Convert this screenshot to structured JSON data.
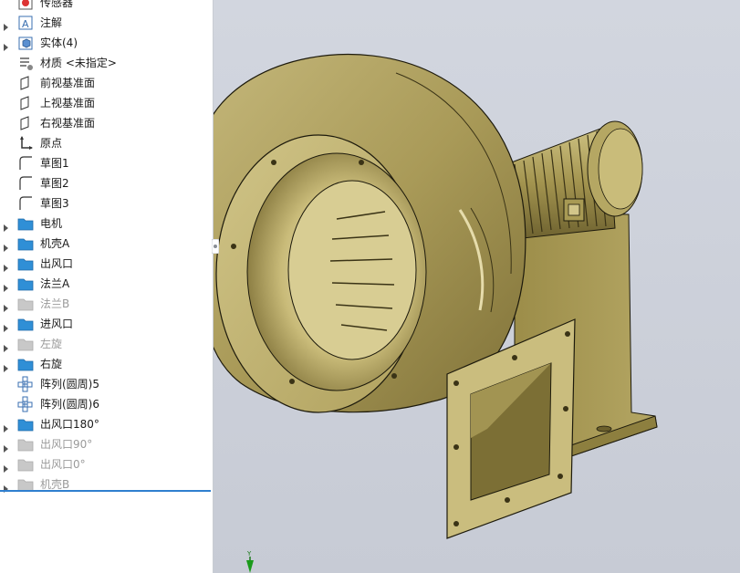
{
  "feature_tree": {
    "items": [
      {
        "label": "传感器",
        "icon": "sensor-icon",
        "expandable": false,
        "suppressed": false
      },
      {
        "label": "注解",
        "icon": "annotation-icon",
        "expandable": true,
        "suppressed": false
      },
      {
        "label": "实体(4)",
        "icon": "solid-bodies-icon",
        "expandable": true,
        "suppressed": false
      },
      {
        "label": "材质 <未指定>",
        "icon": "material-icon",
        "expandable": false,
        "suppressed": false
      },
      {
        "label": "前视基准面",
        "icon": "plane-icon",
        "expandable": false,
        "suppressed": false
      },
      {
        "label": "上视基准面",
        "icon": "plane-icon",
        "expandable": false,
        "suppressed": false
      },
      {
        "label": "右视基准面",
        "icon": "plane-icon",
        "expandable": false,
        "suppressed": false
      },
      {
        "label": "原点",
        "icon": "origin-icon",
        "expandable": false,
        "suppressed": false
      },
      {
        "label": "草图1",
        "icon": "sketch-icon",
        "expandable": false,
        "suppressed": false
      },
      {
        "label": "草图2",
        "icon": "sketch-icon",
        "expandable": false,
        "suppressed": false
      },
      {
        "label": "草图3",
        "icon": "sketch-icon",
        "expandable": false,
        "suppressed": false
      },
      {
        "label": "电机",
        "icon": "folder-icon",
        "expandable": true,
        "suppressed": false
      },
      {
        "label": "机壳A",
        "icon": "folder-icon",
        "expandable": true,
        "suppressed": false
      },
      {
        "label": "出风口",
        "icon": "folder-icon",
        "expandable": true,
        "suppressed": false
      },
      {
        "label": "法兰A",
        "icon": "folder-icon",
        "expandable": true,
        "suppressed": false
      },
      {
        "label": "法兰B",
        "icon": "folder-icon",
        "expandable": true,
        "suppressed": true
      },
      {
        "label": "进风口",
        "icon": "folder-icon",
        "expandable": true,
        "suppressed": false
      },
      {
        "label": "左旋",
        "icon": "folder-icon",
        "expandable": true,
        "suppressed": true
      },
      {
        "label": "右旋",
        "icon": "folder-icon",
        "expandable": true,
        "suppressed": false
      },
      {
        "label": "阵列(圆周)5",
        "icon": "circular-pattern-icon",
        "expandable": false,
        "suppressed": false
      },
      {
        "label": "阵列(圆周)6",
        "icon": "circular-pattern-icon",
        "expandable": false,
        "suppressed": false
      },
      {
        "label": "出风口180°",
        "icon": "folder-icon",
        "expandable": true,
        "suppressed": false
      },
      {
        "label": "出风口90°",
        "icon": "folder-icon",
        "expandable": true,
        "suppressed": true
      },
      {
        "label": "出风口0°",
        "icon": "folder-icon",
        "expandable": true,
        "suppressed": true
      },
      {
        "label": "机壳B",
        "icon": "folder-icon",
        "expandable": true,
        "suppressed": true
      }
    ]
  },
  "viewport": {
    "model": "centrifugal-fan-assembly",
    "triad_axis_label": "Y",
    "model_color": "#b8ab6c",
    "background_color": "#cdd1da"
  },
  "colors": {
    "folder": "#2f8fd6",
    "folder_suppressed": "#c8c8c8",
    "selection_rule": "#2f7fcf",
    "text": "#1a1a1a",
    "text_suppressed": "#9a9a9a"
  }
}
